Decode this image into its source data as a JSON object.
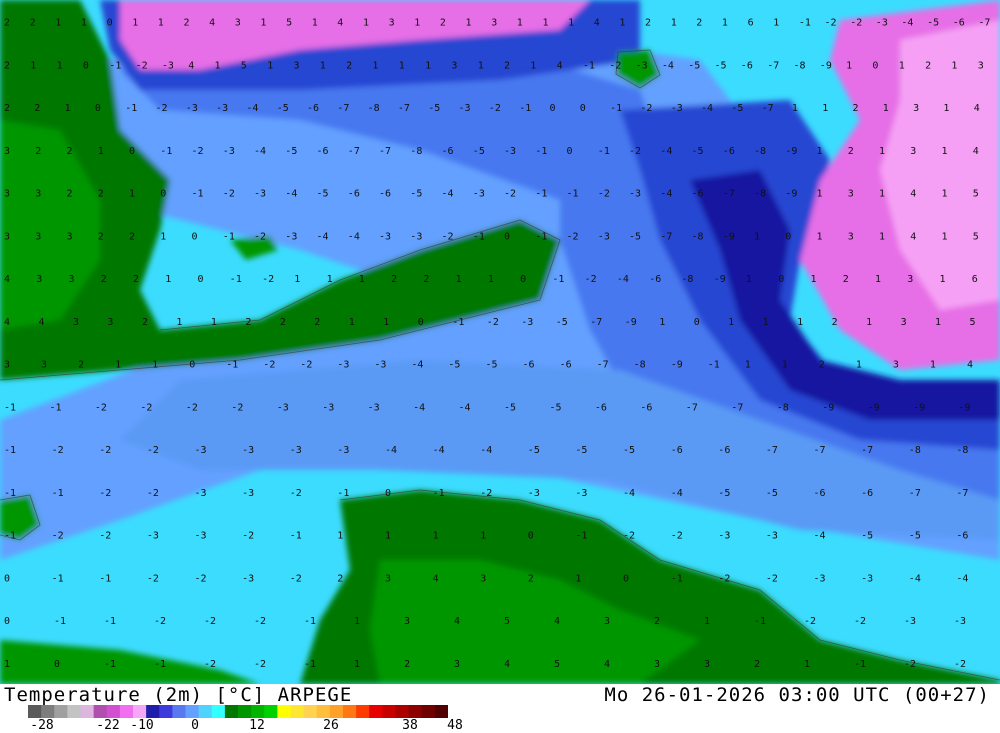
{
  "title": {
    "left": "Temperature (2m) [°C] ARPEGE",
    "right": "Mo 26-01-2026 03:00 UTC (00+27)"
  },
  "colorbar": {
    "tick_labels": [
      "-28",
      "-22",
      "-10",
      "0",
      "12",
      "26",
      "38",
      "48"
    ],
    "colors": [
      "#5a5a5a",
      "#7d7d7d",
      "#a0a0a0",
      "#c3c3c3",
      "#ddb6dd",
      "#b04fb0",
      "#d24fd2",
      "#f06ef0",
      "#f5a6f5",
      "#1e1eaa",
      "#3c3cdc",
      "#5a78f0",
      "#64a0ff",
      "#50d2ff",
      "#32ffff",
      "#007800",
      "#009600",
      "#00b400",
      "#00d200",
      "#ffff00",
      "#ffe632",
      "#ffd250",
      "#ffbe3c",
      "#ffa028",
      "#ff7814",
      "#ff3c00",
      "#e60000",
      "#c80000",
      "#aa0000",
      "#8c0000",
      "#6e0000",
      "#500000"
    ]
  },
  "palette": {
    "deep_purple": "#1414a0",
    "blue": "#2846d2",
    "mid_blue": "#4678f0",
    "light_blue": "#50b4ff",
    "cyan": "#3cdcff",
    "pale_cyan": "#5af0ff",
    "green": "#007800",
    "mid_green": "#009600",
    "light_green": "#00b400",
    "magenta": "#e66ee6",
    "pink": "#f5a0f5"
  },
  "map": {
    "type": "temperature field",
    "number_rows": [
      "2 2 1 1 0 1 1 2 4 3 1 5 1 4 1 3 1 2 1 3 1 1 1 4 1 2 1 2 1 6 1 -1 -2 -2 -3 -4 -5 -6 -7",
      "2 1 1 0 -1 -2 -3 4 1 5 1 3 1 2 1 1 1 3 1 2 1 4 -1 -2 -3 -4 -5 -5 -6 -7 -8 -9 1 0 1 2 1 3",
      "2 2 1 0 -1 -2 -3 -3 -4 -5 -6 -7 -8 -7 -5 -3 -2 -1 0 0 -1 -2 -3 -4 -5 -7 1 1 2 1 3 1 4",
      "3 2 2 1 0 -1 -2 -3 -4 -5 -6 -7 -7 -8 -6 -5 -3 -1 0 -1 -2 -4 -5 -6 -8 -9 1 2 1 3 1 4",
      "3 3 2 2 1 0 -1 -2 -3 -4 -5 -6 -6 -5 -4 -3 -2 -1 -1 -2 -3 -4 -6 -7 -8 -9 1 3 1 4 1 5",
      "3 3 3 2 2 1 0 -1 -2 -3 -4 -4 -3 -3 -2 -1 0 -1 -2 -3 -5 -7 -8 -9 1 0 1 3 1 4 1 5",
      "4 3 3 2 2 1 0 -1 -2 1 1 1 2 2 1 1 0 -1 -2 -4 -6 -8 -9 1 0 1 2 1 3 1 6",
      "4 4 3 3 2 1 1 2 2 2 1 1 0 -1 -2 -3 -5 -7 -9 1 0 1 1 1 2 1 3 1 5",
      "3 3 2 1 1 0 -1 -2 -2 -3 -3 -4 -5 -5 -6 -6 -7 -8 -9 -1 1 1 2 1 3 1 4",
      "-1 -1 -2 -2 -2 -2 -3 -3 -3 -4 -4 -5 -5 -6 -6 -7 -7 -8 -9 -9 -9 -9",
      "-1 -2 -2 -2 -3 -3 -3 -3 -4 -4 -4 -5 -5 -5 -6 -6 -7 -7 -7 -8 -8",
      "-1 -1 -2 -2 -3 -3 -2 -1 0 -1 -2 -3 -3 -4 -4 -5 -5 -6 -6 -7 -7",
      "-1 -2 -2 -3 -3 -2 -1 1 1 1 1 0 -1 -2 -2 -3 -3 -4 -5 -5 -6",
      "0 -1 -1 -2 -2 -3 -2 2 3 4 3 2 1 0 -1 -2 -2 -3 -3 -4 -4",
      "0 -1 -1 -2 -2 -2 -1 1 3 4 5 4 3 2 1 -1 -2 -2 -3 -3",
      "1 0 -1 -1 -2 -2 -1 1 2 3 4 5 4 3 3 2 1 -1 -2 -2"
    ]
  }
}
